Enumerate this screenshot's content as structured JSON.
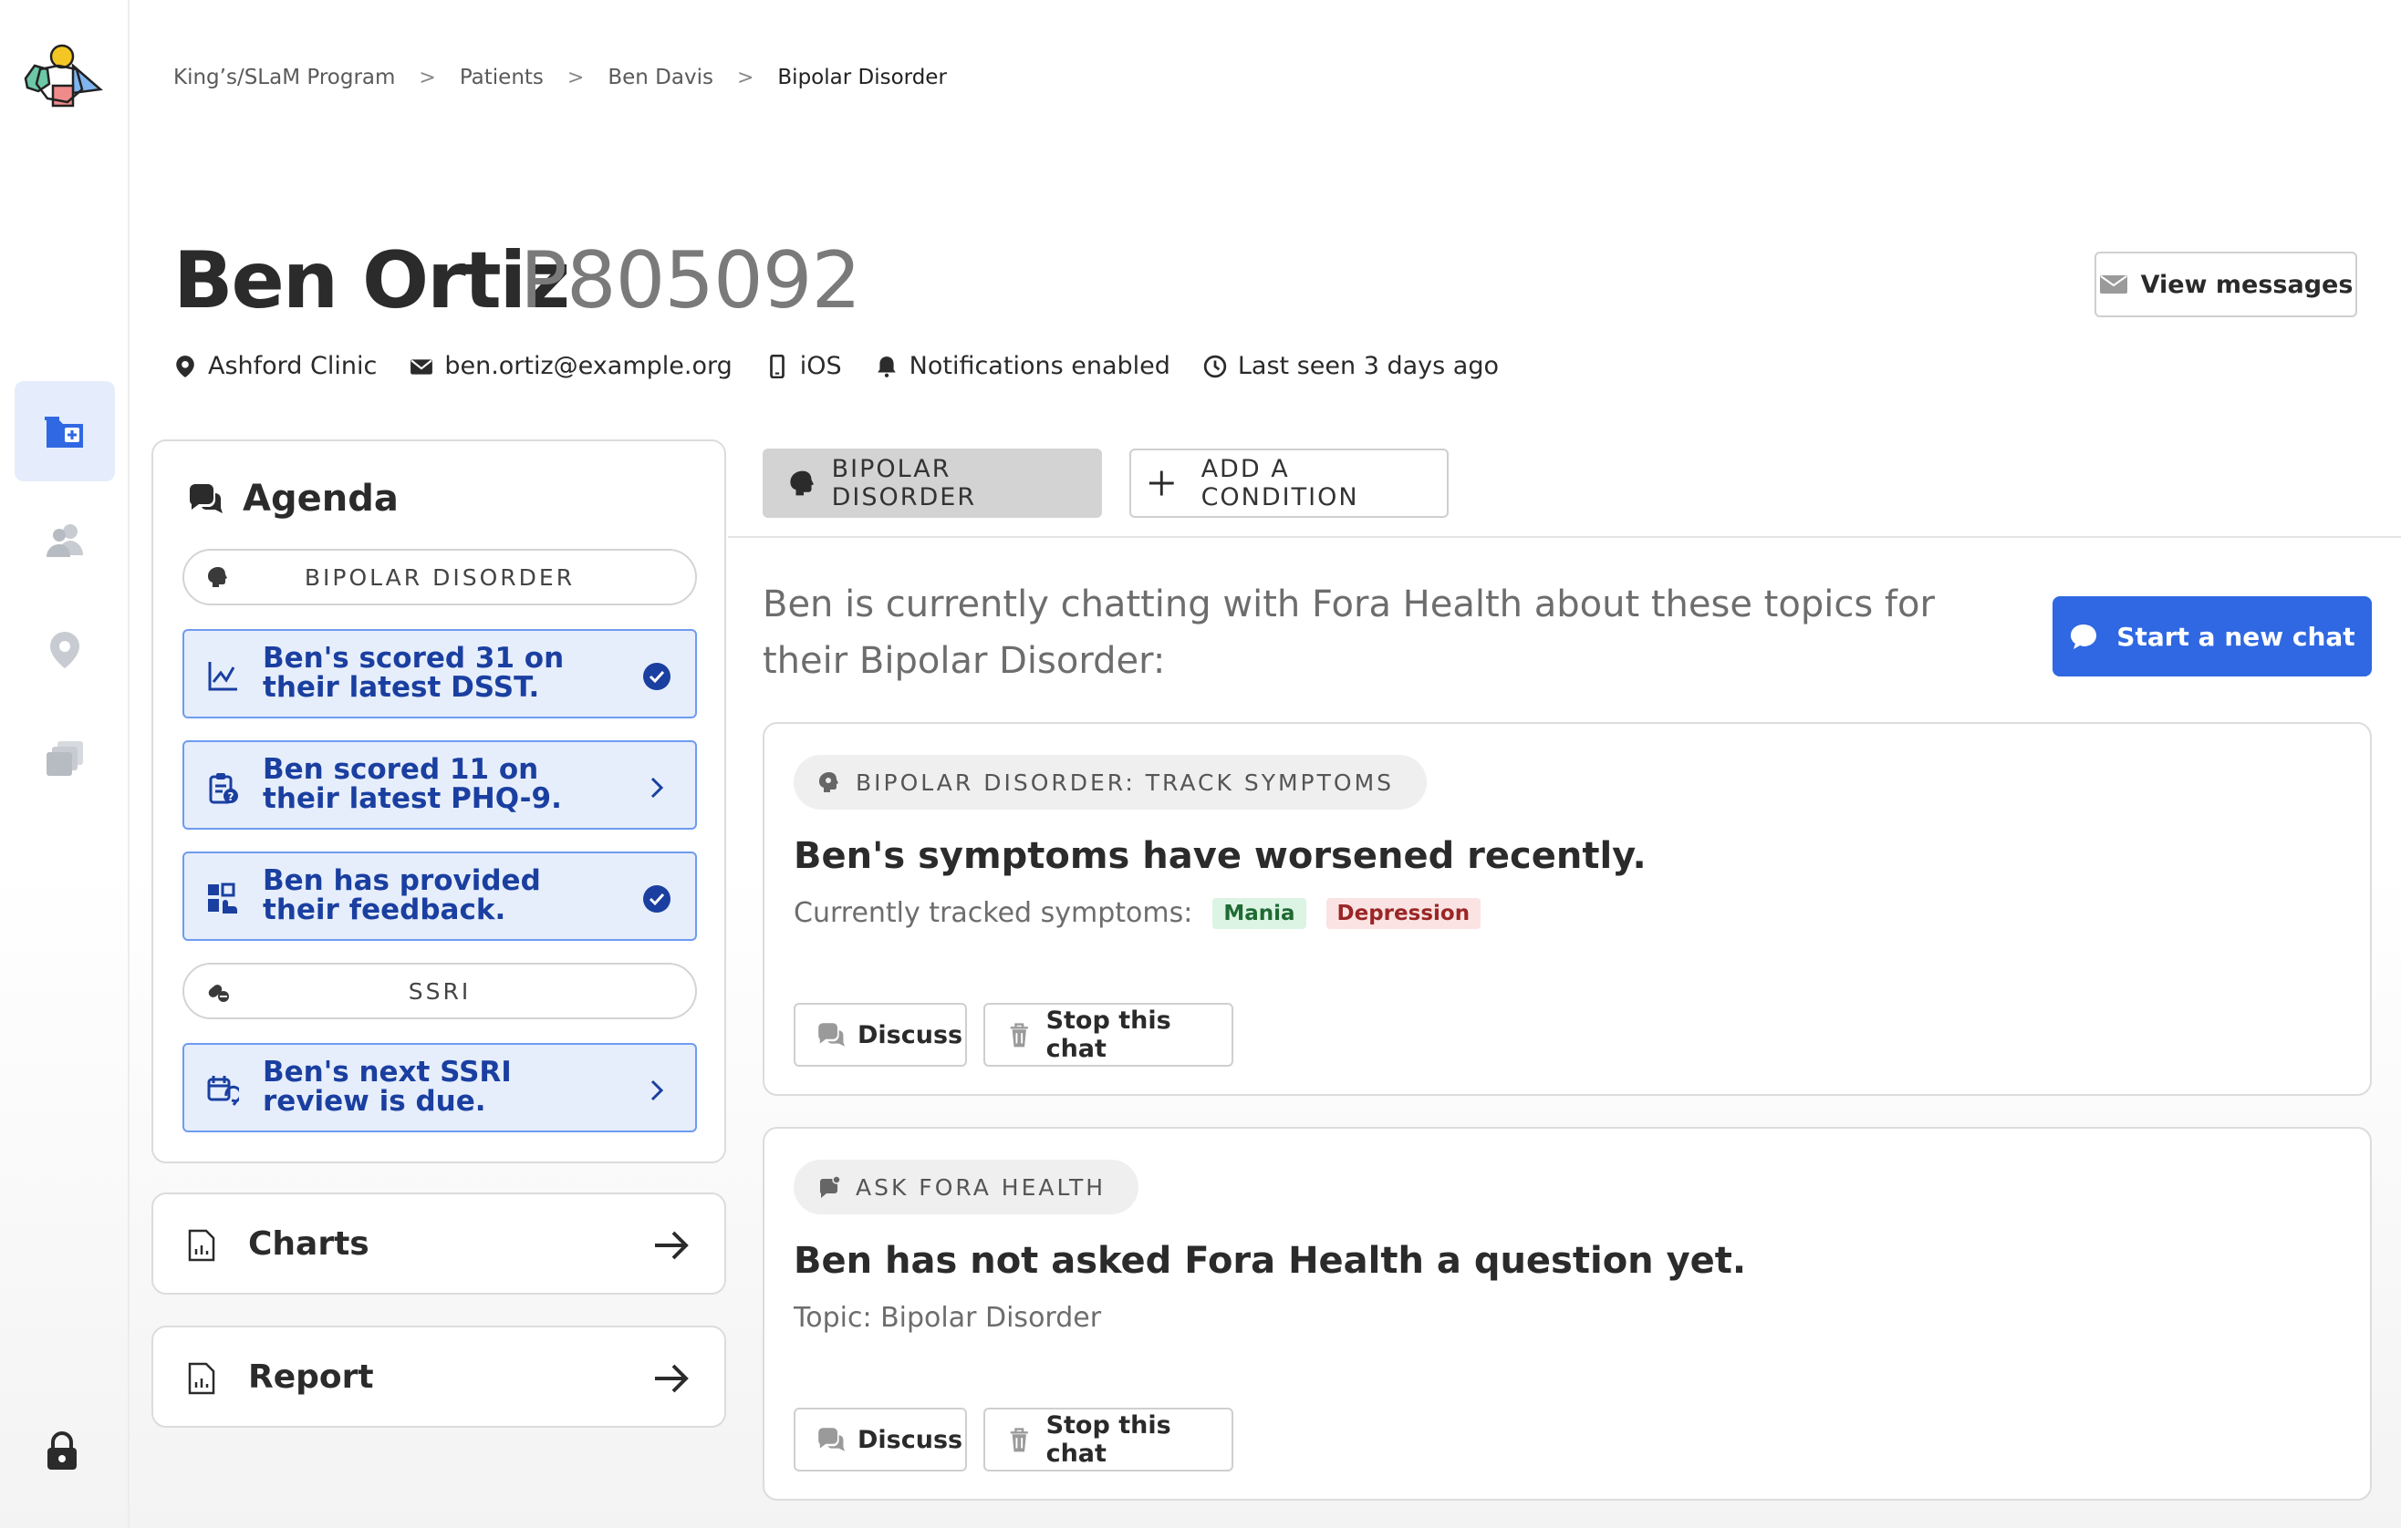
{
  "breadcrumb": [
    "King’s/SLaM Program",
    "Patients",
    "Ben Davis",
    "Bipolar Disorder"
  ],
  "patient": {
    "name": "Ben Ortiz",
    "id": "P805092",
    "clinic": "Ashford Clinic",
    "email": "ben.ortiz@example.org",
    "device": "iOS",
    "notifications": "Notifications enabled",
    "last_seen": "Last seen 3 days ago"
  },
  "header": {
    "view_messages": "View messages"
  },
  "agenda": {
    "title": "Agenda",
    "groups": [
      {
        "label": "BIPOLAR DISORDER",
        "items": [
          {
            "text": "Ben's scored 31 on their latest DSST.",
            "icon": "line-chart-icon",
            "status": "check"
          },
          {
            "text": "Ben scored 11 on their latest PHQ-9.",
            "icon": "clipboard-question-icon",
            "status": "chevron"
          },
          {
            "text": "Ben has provided their feedback.",
            "icon": "feedback-icon",
            "status": "check"
          }
        ]
      },
      {
        "label": "SSRI",
        "items": [
          {
            "text": "Ben's next SSRI review is due.",
            "icon": "calendar-refresh-icon",
            "status": "chevron"
          }
        ]
      }
    ]
  },
  "links": {
    "charts": "Charts",
    "report": "Report"
  },
  "tabs": {
    "active": "BIPOLAR DISORDER",
    "add": "ADD A CONDITION"
  },
  "main": {
    "intro": "Ben is currently chatting with Fora Health about these topics for their Bipolar Disorder:",
    "start_chat": "Start a new chat",
    "topics": [
      {
        "pill": "BIPOLAR DISORDER: TRACK SYMPTOMS",
        "headline": "Ben's symptoms have worsened recently.",
        "sub_label": "Currently tracked symptoms:",
        "tags": [
          "Mania",
          "Depression"
        ],
        "discuss": "Discuss",
        "stop": "Stop this chat"
      },
      {
        "pill": "ASK FORA HEALTH",
        "headline": "Ben has not asked Fora Health a question yet.",
        "sub_label": "Topic: Bipolar Disorder",
        "discuss": "Discuss",
        "stop": "Stop this chat"
      }
    ]
  },
  "colors": {
    "accent": "#2f68e2",
    "card_bg": "#e6eefc",
    "card_border": "#6f9bf0",
    "card_text": "#1a3fa0"
  }
}
